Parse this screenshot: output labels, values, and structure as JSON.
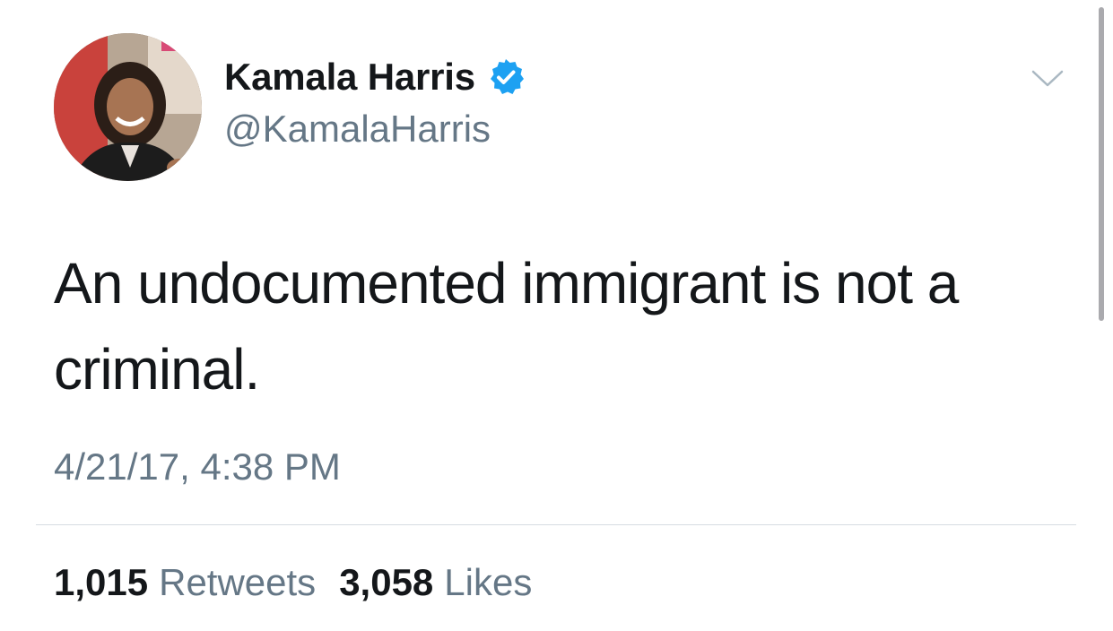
{
  "author": {
    "display_name": "Kamala Harris",
    "handle": "@KamalaHarris",
    "verified": true,
    "avatar_icon": "profile-photo"
  },
  "tweet": {
    "text": "An undocumented immigrant is not a criminal.",
    "timestamp": "4/21/17, 4:38 PM"
  },
  "stats": {
    "retweets_count": "1,015",
    "retweets_label": "Retweets",
    "likes_count": "3,058",
    "likes_label": "Likes"
  },
  "icons": {
    "verified": "verified-badge-icon",
    "menu": "chevron-down-icon"
  },
  "colors": {
    "text_primary": "#14171a",
    "text_secondary": "#657786",
    "verified_blue": "#1da1f2",
    "divider": "#d6dce1"
  }
}
